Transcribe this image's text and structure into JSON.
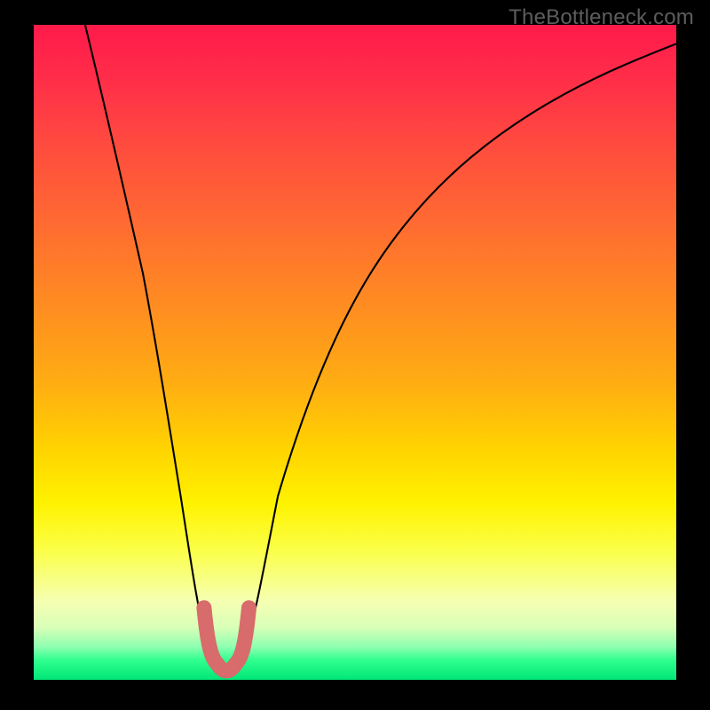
{
  "watermark": {
    "text": "TheBottleneck.com"
  },
  "chart_data": {
    "type": "line",
    "title": "",
    "xlabel": "",
    "ylabel": "",
    "xlim": [
      0,
      100
    ],
    "ylim": [
      0,
      100
    ],
    "grid": false,
    "legend": false,
    "background_gradient": [
      "#ff1a4a",
      "#ff4a3f",
      "#ff8a22",
      "#ffd400",
      "#fff200",
      "#f6ffb2",
      "#2fff8e",
      "#00e676"
    ],
    "series": [
      {
        "name": "bottleneck-curve",
        "x": [
          8.0,
          11.0,
          14.0,
          17.0,
          20.0,
          22.0,
          24.0,
          25.5,
          27.0,
          28.0,
          29.0,
          30.0,
          31.0,
          32.0,
          33.5,
          35.0,
          38.0,
          42.0,
          48.0,
          55.0,
          63.0,
          72.0,
          82.0,
          92.0,
          100.0
        ],
        "y": [
          100.0,
          88.0,
          75.0,
          62.0,
          49.0,
          38.0,
          27.0,
          18.0,
          10.0,
          5.0,
          2.0,
          1.0,
          2.0,
          5.0,
          11.0,
          18.0,
          28.0,
          38.0,
          48.0,
          56.0,
          62.0,
          67.0,
          70.0,
          72.0,
          73.0
        ],
        "color": "#000000"
      },
      {
        "name": "optimal-region",
        "x": [
          26.5,
          27.5,
          28.5,
          29.5,
          30.5,
          31.5,
          32.5,
          33.5
        ],
        "y": [
          11.0,
          6.0,
          2.5,
          1.0,
          1.0,
          2.5,
          6.0,
          11.0
        ],
        "color": "#d86b6b",
        "stroke_width": 17
      }
    ]
  }
}
